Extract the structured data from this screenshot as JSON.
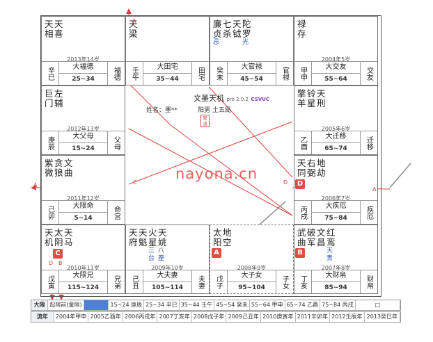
{
  "palaces": [
    {
      "stars": [
        {
          "n": "天相"
        },
        {
          "n": "天喜"
        }
      ],
      "age": "2013年14岁",
      "gz": "辛巳",
      "range": "25~34",
      "pal": "福德",
      "range_red": true
    },
    {
      "stars": [
        {
          "n": "天梁"
        }
      ],
      "age": "",
      "gz": "壬午",
      "range": "35~44",
      "pal": "田宅"
    },
    {
      "stars": [
        {
          "n": "廉贞"
        },
        {
          "n": "七杀",
          "m": ""
        },
        {
          "n": "天钺"
        },
        {
          "n": "陀罗"
        }
      ],
      "muts": [
        "忌",
        "",
        "",
        "光"
      ],
      "age": "",
      "gz": "癸未",
      "range": "45~54",
      "pal": "官禄"
    },
    {
      "stars": [
        {
          "n": "禄存"
        }
      ],
      "age": "2004年5岁",
      "gz": "甲申",
      "range": "55~64",
      "pal": "交友"
    },
    {
      "stars": [
        {
          "n": "巨门"
        },
        {
          "n": "左辅"
        }
      ],
      "age": "2012年13岁",
      "gz": "庚辰",
      "range": "15~24",
      "pal": "父母"
    },
    {
      "stars": [
        {
          "n": "擎羊"
        },
        {
          "n": "铃星"
        },
        {
          "n": "天刑"
        }
      ],
      "age": "2005年6岁",
      "gz": "乙酉",
      "range": "65~74",
      "pal": "迁移"
    },
    {
      "stars": [
        {
          "n": "紫微"
        },
        {
          "n": "贪狼"
        },
        {
          "n": "文曲"
        }
      ],
      "age": "2011年12岁",
      "gz": "己卯",
      "range": "5~14",
      "pal": "命宫"
    },
    {
      "stars": [
        {
          "n": "天同"
        },
        {
          "n": "右弼"
        },
        {
          "n": "地劫"
        }
      ],
      "age": "2006年7岁",
      "gz": "丙戌",
      "range": "75~84",
      "pal": "疾厄"
    },
    {
      "stars": [
        {
          "n": "天机"
        },
        {
          "n": "太阴"
        },
        {
          "n": "天马"
        }
      ],
      "age": "2010年11岁",
      "gz": "戊寅",
      "range": "115~124",
      "pal": "兄弟"
    },
    {
      "stars": [
        {
          "n": "天府"
        },
        {
          "n": "天魁"
        },
        {
          "n": "火星"
        },
        {
          "n": "天姚"
        }
      ],
      "muts": [
        "",
        "",
        "三台",
        "八座"
      ],
      "age": "2009年10岁",
      "gz": "己丑",
      "range": "105~114",
      "pal": "夫妻"
    },
    {
      "stars": [
        {
          "n": "太阳"
        },
        {
          "n": "地空"
        }
      ],
      "age": "2008年9岁",
      "gz": "戊子",
      "range": "95~104",
      "pal": "子女"
    },
    {
      "stars": [
        {
          "n": "武曲"
        },
        {
          "n": "破军"
        },
        {
          "n": "文昌"
        },
        {
          "n": "红鸾"
        }
      ],
      "muts": [
        "",
        "",
        "",
        "天贵"
      ],
      "age": "2007年8岁",
      "gz": "丁亥",
      "range": "85~94",
      "pal": "财帛"
    }
  ],
  "limits": {
    "d_ming": "大福德",
    "d_tian": "大田宅",
    "d_guan": "大官禄",
    "d_jiao": "大交友",
    "d_fu": "大父母",
    "d_qian": "大迁移",
    "d_ming2": "大限命",
    "d_ji": "大疾厄",
    "d_xiong": "大限兄",
    "d_qi": "大夫妻",
    "d_zi": "大子女",
    "d_cai": "大财帛"
  },
  "center": {
    "title": "文墨天机",
    "version": "pro 2.0.2",
    "brand": "CSVUC",
    "name": "姓名：墨**",
    "gender": "阳男 土五局",
    "stamp": "限流"
  },
  "badges": {
    "A": "A",
    "B": "B",
    "C": "C",
    "D": "D"
  },
  "watermark": "nayona.cn",
  "footer": {
    "row1": [
      "大限",
      "起限前(童限)",
      "",
      "15~24 庚辰",
      "25~34 辛巳",
      "35~44 壬午",
      "45~54 癸未",
      "55~64 甲申",
      "65~74 乙酉",
      "75~84 丙戌",
      "□"
    ],
    "row2": [
      "流年",
      "2004年甲申",
      "2005乙酉年",
      "2006丙戌年",
      "2007丁亥年",
      "2008戊子年",
      "2009己丑年",
      "2010庚寅年",
      "2011辛卯年",
      "2012壬辰年",
      "2013癸巳年"
    ]
  },
  "colors": {
    "line": "#d9413a",
    "badge": "#e04b44",
    "highlight": "#4f7fdc"
  }
}
